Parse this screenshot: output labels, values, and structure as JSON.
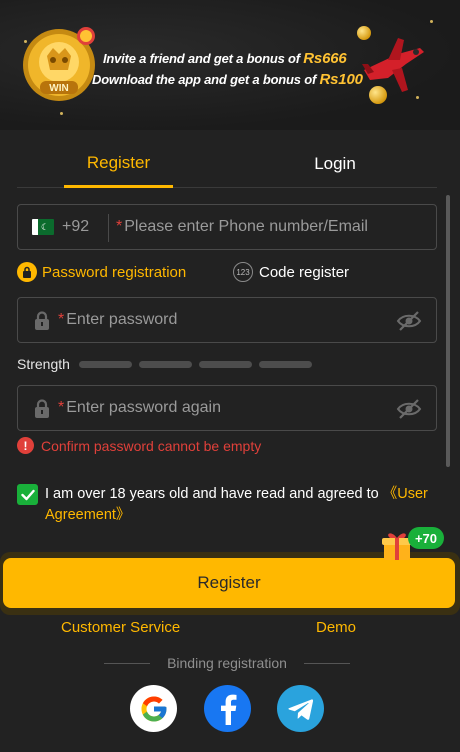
{
  "banner": {
    "medal_text": "WIN",
    "line1_prefix": "Invite a friend and get a bonus of ",
    "line1_amount": "Rs666",
    "line2_prefix": "Download the app and get a bonus of ",
    "line2_amount": "Rs100"
  },
  "tabs": {
    "register": "Register",
    "login": "Login"
  },
  "phone": {
    "country_code": "+92",
    "required_mark": "*",
    "placeholder": "Please enter Phone number/Email"
  },
  "modes": {
    "password": "Password registration",
    "code": "Code register",
    "code_badge": "123"
  },
  "password": {
    "required_mark": "*",
    "placeholder": "Enter password"
  },
  "strength": {
    "label": "Strength",
    "level": 0,
    "segments": 4
  },
  "confirm": {
    "required_mark": "*",
    "placeholder": "Enter password again"
  },
  "error": {
    "icon": "!",
    "text": "Confirm password cannot be empty"
  },
  "agreement": {
    "checked": true,
    "text": "I am over 18 years old and have read and agreed to ",
    "link": "《User Agreement》"
  },
  "register_button": {
    "label": "Register",
    "bonus": "+70"
  },
  "links": {
    "customer_service": "Customer Service",
    "demo": "Demo"
  },
  "binding": {
    "label": "Binding registration"
  },
  "social": [
    "google-icon",
    "facebook-icon",
    "telegram-icon"
  ],
  "colors": {
    "accent": "#ffb800",
    "error": "#e0403a",
    "success": "#19b03a",
    "background": "#222222"
  }
}
